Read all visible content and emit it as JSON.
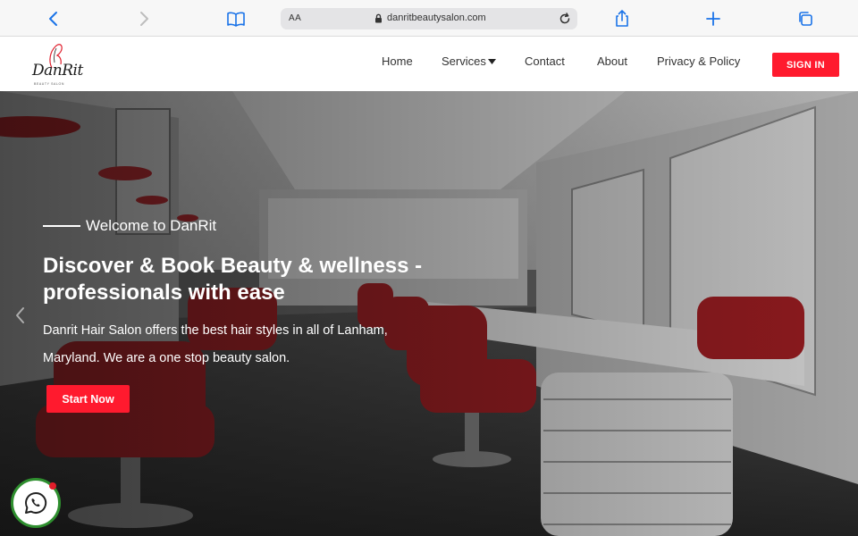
{
  "browser": {
    "text_size_label": "AA",
    "url": "danritbeautysalon.com"
  },
  "brand": {
    "logo_text": "DanRit",
    "logo_subtext": "BEAUTY SALON",
    "accent_color": "#ff1a2e"
  },
  "nav": {
    "items": [
      "Home",
      "Services",
      "Contact",
      "About",
      "Privacy & Policy"
    ],
    "signin_label": "SIGN IN"
  },
  "hero": {
    "kicker": "Welcome to DanRit",
    "headline": "Discover & Book Beauty & wellness - professionals with ease",
    "description": "Danrit Hair Salon offers the best hair styles in all of Lanham, Maryland. We are a one stop beauty salon.",
    "cta_label": "Start Now"
  },
  "icons": {
    "back": "chevron-left-icon",
    "forward": "chevron-right-icon",
    "bookmarks": "book-icon",
    "lock": "lock-icon",
    "reload": "reload-icon",
    "share": "share-icon",
    "new_tab": "plus-icon",
    "tabs": "tabs-icon",
    "whatsapp": "whatsapp-icon"
  }
}
